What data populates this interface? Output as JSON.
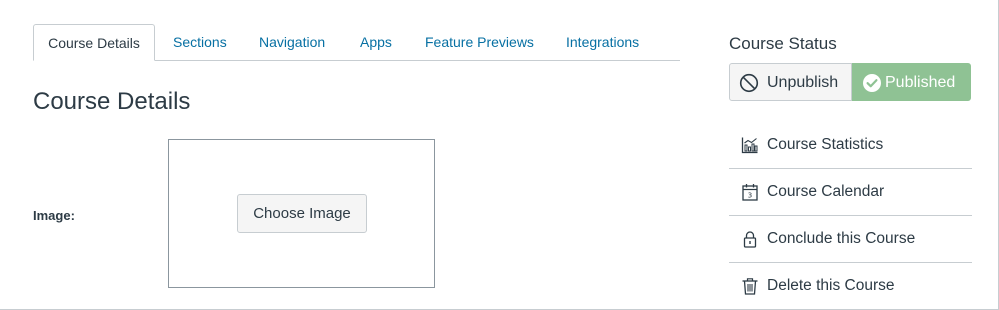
{
  "tabs": [
    {
      "label": "Course Details",
      "active": true
    },
    {
      "label": "Sections",
      "active": false
    },
    {
      "label": "Navigation",
      "active": false
    },
    {
      "label": "Apps",
      "active": false
    },
    {
      "label": "Feature Previews",
      "active": false
    },
    {
      "label": "Integrations",
      "active": false
    }
  ],
  "main": {
    "title": "Course Details",
    "image_label": "Image:",
    "choose_image_label": "Choose Image"
  },
  "sidebar": {
    "status_title": "Course Status",
    "unpublish": {
      "label": "Unpublish",
      "icon": "unpublish-icon"
    },
    "published": {
      "label": "Published",
      "icon": "check-circle-icon",
      "color": "#8fc294"
    },
    "items": [
      {
        "label": "Course Statistics",
        "icon": "stats-icon"
      },
      {
        "label": "Course Calendar",
        "icon": "calendar-icon"
      },
      {
        "label": "Conclude this Course",
        "icon": "lock-icon"
      },
      {
        "label": "Delete this Course",
        "icon": "trash-icon"
      }
    ]
  },
  "colors": {
    "link": "#0770a3",
    "text": "#2d3b45",
    "border": "#c7cdd1",
    "published_green": "#8fc294"
  }
}
